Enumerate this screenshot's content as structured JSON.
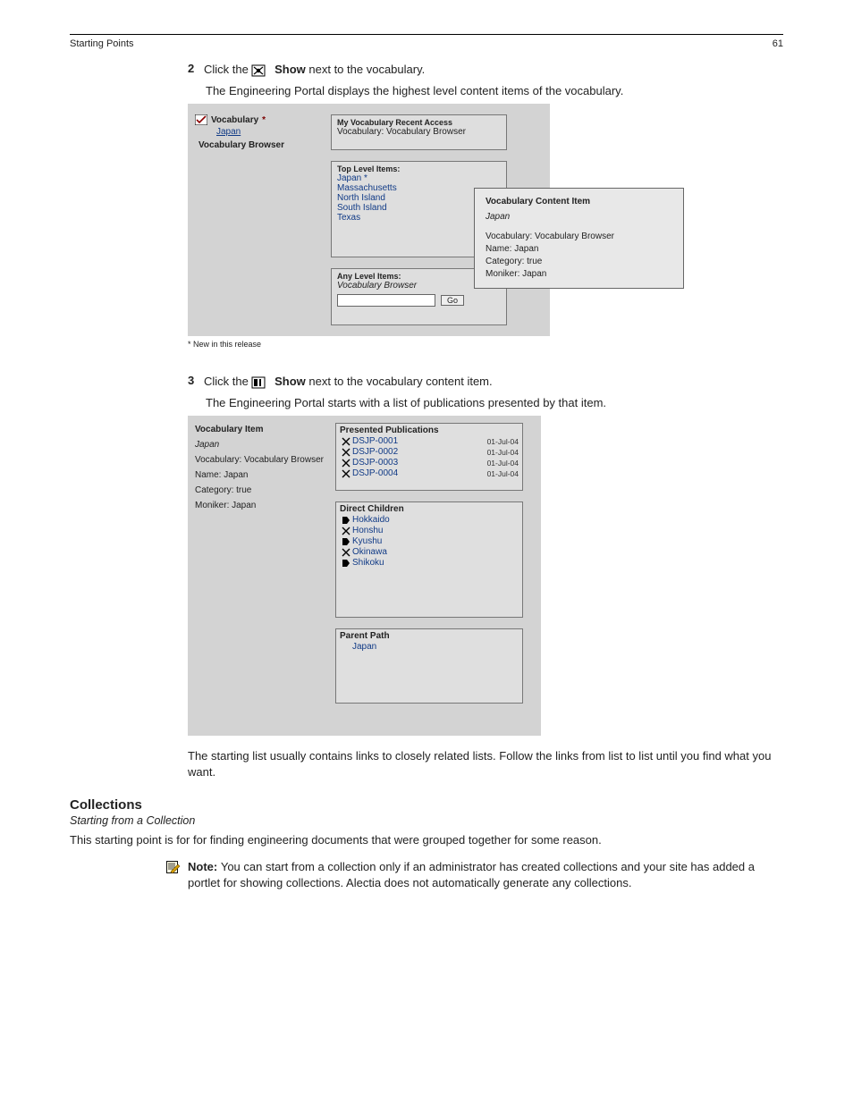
{
  "header": {
    "left": "Starting Points",
    "right": "61"
  },
  "step2": {
    "num": "2",
    "text_a": "Click the ",
    "icon_word": "Show",
    "text_b": " next to the vocabulary."
  },
  "step2_sub": "The Engineering Portal displays the highest level content items of the vocabulary.",
  "fig1": {
    "left_rows": [
      {
        "icon": "doc",
        "label": "Vocabulary",
        "star": true
      },
      {
        "icon": "blank",
        "label": "Japan",
        "clickable": true
      },
      {
        "icon": "blank",
        "label": "Vocabulary Browser",
        "star": false
      }
    ],
    "p1": {
      "hdr": "My Vocabulary Recent Access",
      "line": "Vocabulary: Vocabulary Browser"
    },
    "p2": {
      "hdr": "Top Level Items:",
      "items": [
        {
          "label": "Japan",
          "star": true
        },
        {
          "label": "Massachusetts",
          "star": false
        },
        {
          "label": "North Island",
          "star": false
        },
        {
          "label": "South Island",
          "star": false
        },
        {
          "label": "Texas",
          "star": false
        }
      ]
    },
    "p3": {
      "hdr": "Any Level Items:",
      "sub": "Vocabulary Browser",
      "input": "",
      "btn": "Go"
    },
    "popup": {
      "title": "Vocabulary Content Item",
      "subtitle": "Japan",
      "lines": [
        "Vocabulary: Vocabulary Browser",
        "Name: Japan",
        "Category: true",
        "Moniker: Japan"
      ]
    },
    "caption": "* New in this release"
  },
  "step3": {
    "num": "3",
    "text_a": "Click the ",
    "icon_word": "Show",
    "text_b": " next to the vocabulary content item."
  },
  "step3_sub": "The Engineering Portal starts with a list of publications presented by that item.",
  "fig2": {
    "left_title": "Vocabulary Item",
    "left_name": "Japan",
    "left_lines": [
      "Vocabulary: Vocabulary Browser",
      "Name: Japan",
      "Category: true",
      "Moniker: Japan"
    ],
    "pA": {
      "hdr": "Presented Publications",
      "rows": [
        {
          "ico": "x",
          "name": "DSJP-0001",
          "date": "01-Jul-04"
        },
        {
          "ico": "x",
          "name": "DSJP-0002",
          "date": "01-Jul-04"
        },
        {
          "ico": "x",
          "name": "DSJP-0003",
          "date": "01-Jul-04"
        },
        {
          "ico": "x",
          "name": "DSJP-0004",
          "date": "01-Jul-04"
        }
      ]
    },
    "pB": {
      "hdr": "Direct Children",
      "rows": [
        {
          "ico": "tag",
          "name": "Hokkaido"
        },
        {
          "ico": "x",
          "name": "Honshu"
        },
        {
          "ico": "tag",
          "name": "Kyushu"
        },
        {
          "ico": "x",
          "name": "Okinawa"
        },
        {
          "ico": "tag",
          "name": "Shikoku"
        }
      ]
    },
    "pC": {
      "hdr": "Parent Path",
      "rows": [
        {
          "ico": "blank",
          "name": "Japan"
        }
      ]
    }
  },
  "after_fig2": "The starting list usually contains links to closely related lists. Follow the links from list to list until you find what you want.",
  "section": {
    "title": "Collections",
    "subtitle": "Starting from a Collection",
    "para": "This starting point is for for finding engineering documents that were grouped together for some reason."
  },
  "note": {
    "bold": "Note: ",
    "text": "You can start from a collection only if an administrator has created collections and your site has added a portlet for showing collections. Alectia does not automatically generate any collections."
  }
}
